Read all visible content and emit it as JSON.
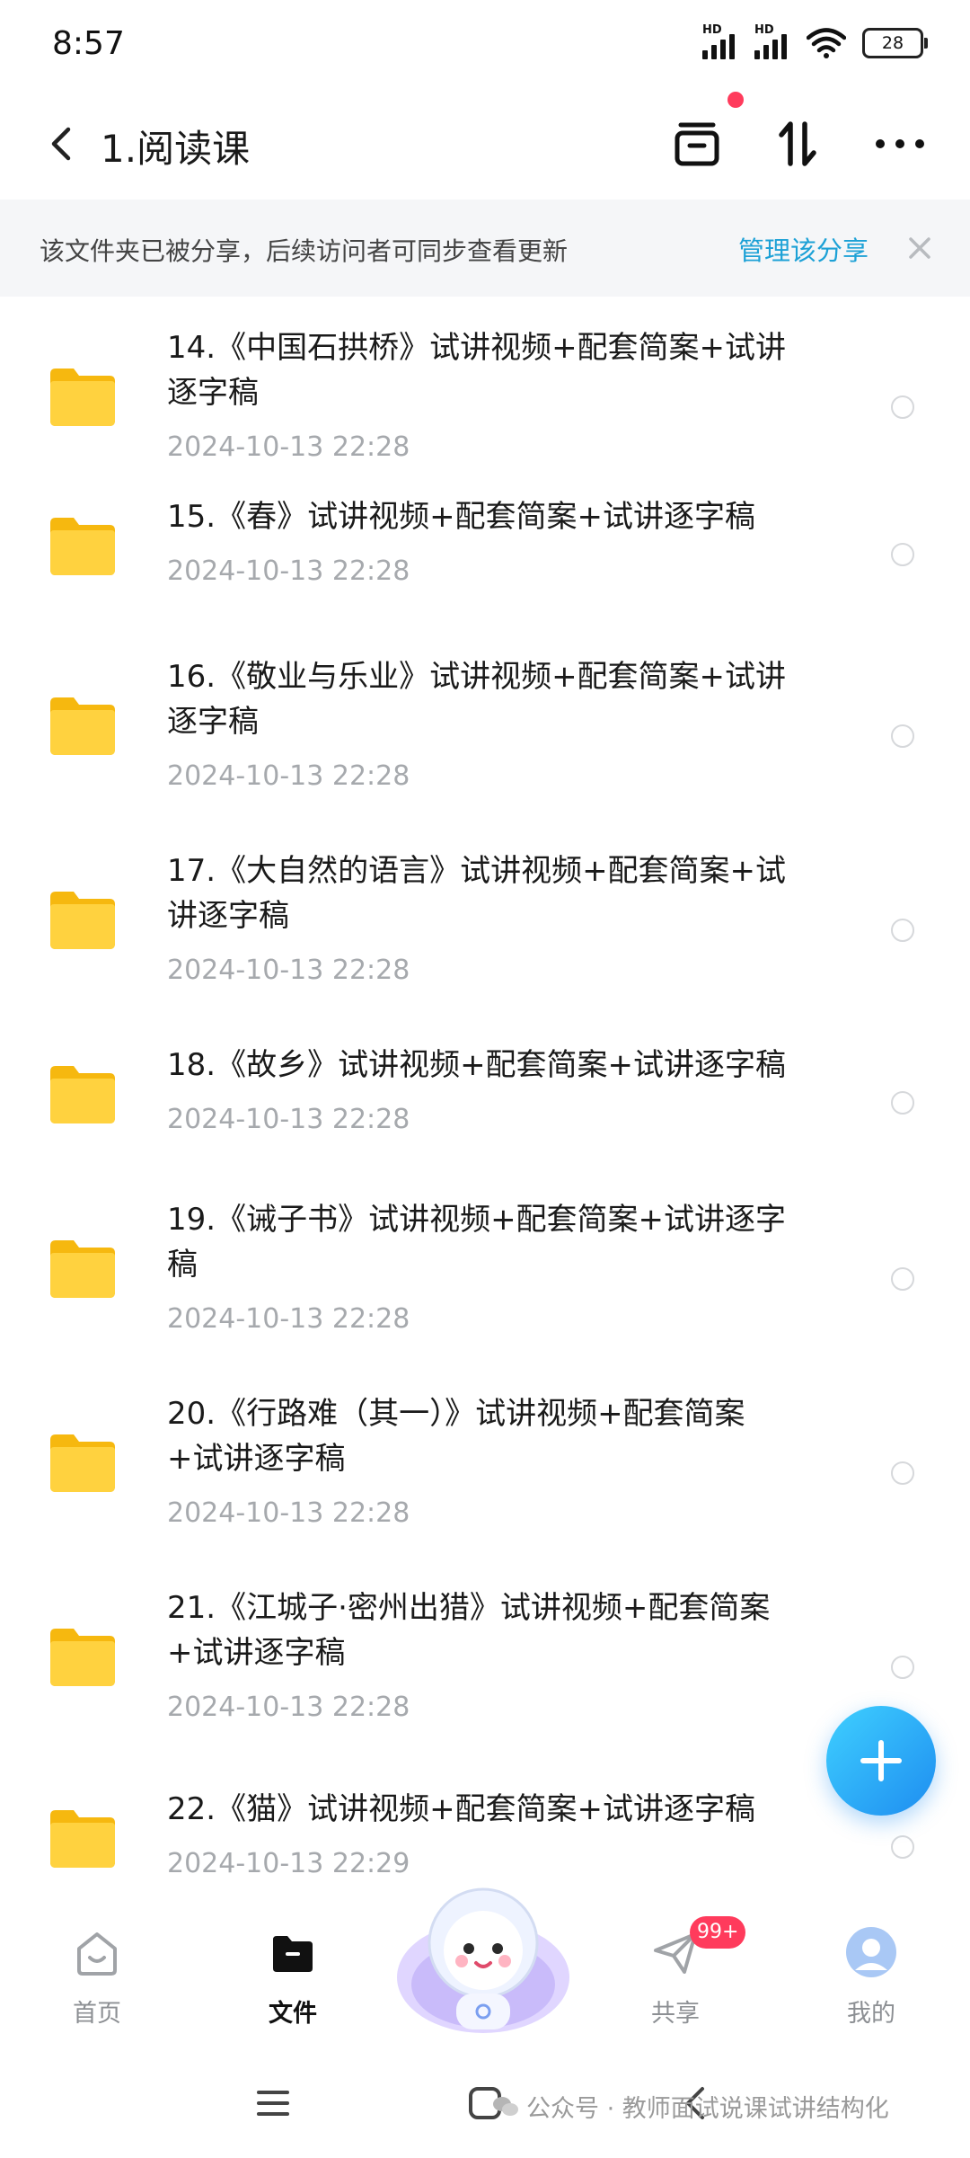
{
  "status_bar": {
    "time": "8:57",
    "battery": "28",
    "signal_label": "HD"
  },
  "header": {
    "title": "1.阅读课"
  },
  "banner": {
    "text": "该文件夹已被分享，后续访问者可同步查看更新",
    "link": "管理该分享"
  },
  "files": [
    {
      "line1": "14.《中国石拱桥》试讲视频+配套简案+试讲",
      "line2": "逐字稿",
      "date": "2024-10-13  22:28"
    },
    {
      "line1": "15.《春》试讲视频+配套简案+试讲逐字稿",
      "line2": "",
      "date": "2024-10-13  22:28"
    },
    {
      "line1": "16.《敬业与乐业》试讲视频+配套简案+试讲",
      "line2": "逐字稿",
      "date": "2024-10-13  22:28"
    },
    {
      "line1": "17.《大自然的语言》试讲视频+配套简案+试",
      "line2": "讲逐字稿",
      "date": "2024-10-13  22:28"
    },
    {
      "line1": "18.《故乡》试讲视频+配套简案+试讲逐字稿",
      "line2": "",
      "date": "2024-10-13  22:28"
    },
    {
      "line1": "19.《诫子书》试讲视频+配套简案+试讲逐字",
      "line2": "稿",
      "date": "2024-10-13  22:28"
    },
    {
      "line1": "20.《行路难（其一）》试讲视频+配套简案",
      "line2": "+试讲逐字稿",
      "date": "2024-10-13  22:28"
    },
    {
      "line1": "21.《江城子·密州出猎》试讲视频+配套简案",
      "line2": "+试讲逐字稿",
      "date": "2024-10-13  22:28"
    },
    {
      "line1": "22.《猫》试讲视频+配套简案+试讲逐字稿",
      "line2": "",
      "date": "2024-10-13  22:29"
    }
  ],
  "bottom_nav": {
    "home": "首页",
    "files": "文件",
    "share": "共享",
    "mine": "我的",
    "share_badge": "99+"
  },
  "watermark": "公众号 · 教师面试说课试讲结构化",
  "colors": {
    "accent": "#1da1d6",
    "badge": "#ff3b5c",
    "folder": "#ffd23f",
    "fab": "#1e8df0"
  }
}
